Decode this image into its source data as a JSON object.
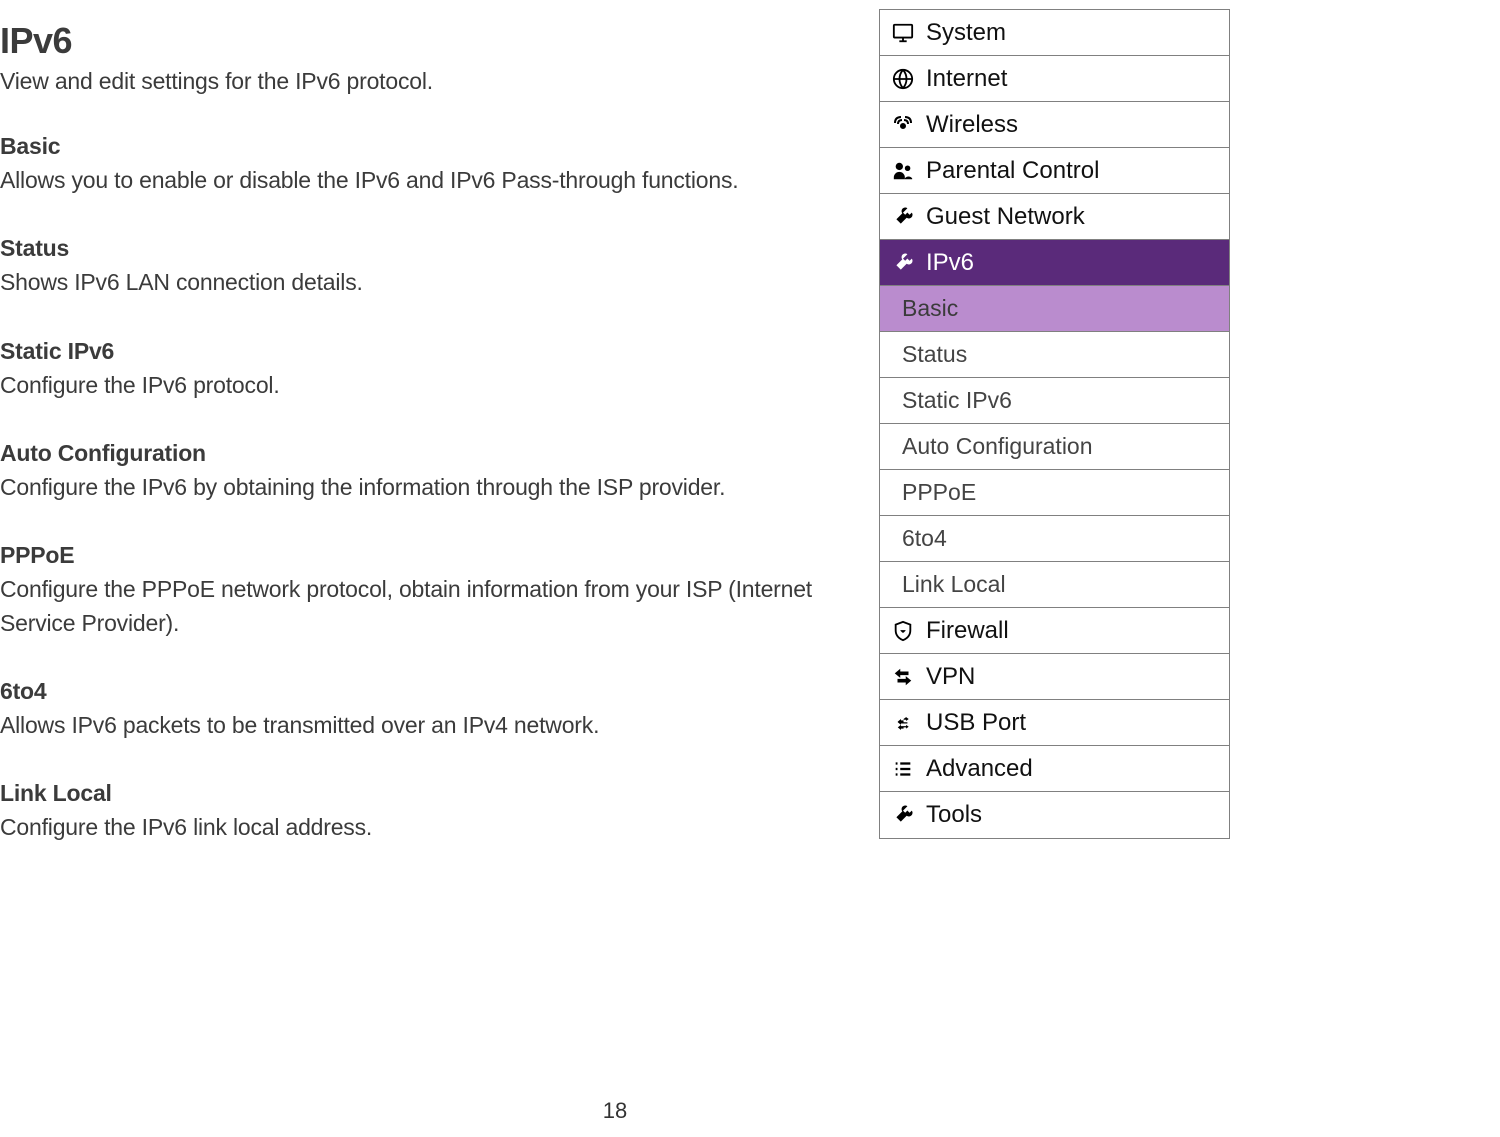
{
  "page": {
    "title": "IPv6",
    "description": "View and edit settings for the IPv6 protocol.",
    "number": "18"
  },
  "sections": [
    {
      "heading": "Basic",
      "body": "Allows you to enable or disable the IPv6 and IPv6 Pass-through functions."
    },
    {
      "heading": "Status",
      "body": "Shows IPv6 LAN connection details."
    },
    {
      "heading": "Static IPv6",
      "body": "Configure the IPv6 protocol."
    },
    {
      "heading": "Auto Configuration",
      "body": "Configure the IPv6 by obtaining the information through the ISP provider."
    },
    {
      "heading": "PPPoE",
      "body": "Configure the PPPoE network protocol, obtain information from your ISP (Internet Service Provider)."
    },
    {
      "heading": "6to4",
      "body": "Allows IPv6 packets to be transmitted over an IPv4 network."
    },
    {
      "heading": "Link Local",
      "body": "Configure the IPv6 link local address."
    }
  ],
  "sidebar": {
    "items": [
      {
        "label": "System",
        "icon": "monitor"
      },
      {
        "label": "Internet",
        "icon": "globe"
      },
      {
        "label": "Wireless",
        "icon": "wifi"
      },
      {
        "label": "Parental Control",
        "icon": "users"
      },
      {
        "label": "Guest Network",
        "icon": "wrench"
      },
      {
        "label": "IPv6",
        "icon": "wrench",
        "active": true
      },
      {
        "label": "Firewall",
        "icon": "shield"
      },
      {
        "label": "VPN",
        "icon": "arrows"
      },
      {
        "label": "USB Port",
        "icon": "usb"
      },
      {
        "label": "Advanced",
        "icon": "list"
      },
      {
        "label": "Tools",
        "icon": "wrench"
      }
    ],
    "subitems": [
      {
        "label": "Basic",
        "active": true
      },
      {
        "label": "Status"
      },
      {
        "label": "Static IPv6"
      },
      {
        "label": "Auto Configuration"
      },
      {
        "label": "PPPoE"
      },
      {
        "label": "6to4"
      },
      {
        "label": "Link Local"
      }
    ]
  }
}
